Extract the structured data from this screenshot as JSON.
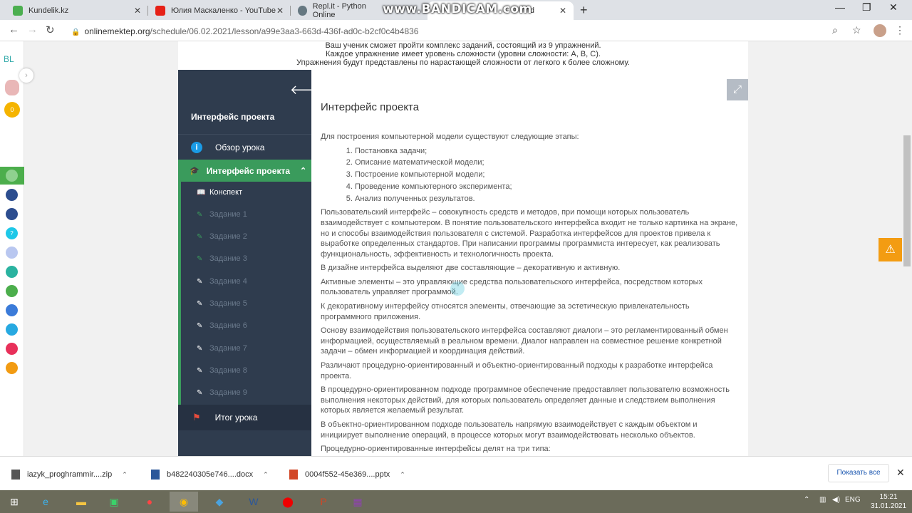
{
  "browser": {
    "tabs": [
      {
        "title": "Kundelik.kz",
        "icon": "kundelik-icon",
        "color": "#4caf50"
      },
      {
        "title": "Юлия Маскаленко - YouTube",
        "icon": "youtube-icon",
        "color": "#e62117"
      },
      {
        "title": "Repl.it - Python Online",
        "icon": "replit-icon",
        "color": "#667881"
      },
      {
        "title": "nd",
        "icon": "page-icon",
        "color": "#aaaaaa"
      }
    ],
    "watermark": "www.BANDICAM.com",
    "url_host": "onlinemektep.org",
    "url_path": "/schedule/06.02.2021/lesson/a99e3aa3-663d-436f-ad0c-b2cf0c4b4836"
  },
  "extension_bar": {
    "logo": "BL",
    "coin": "0"
  },
  "top_notes": [
    "Ваш ученик сможет пройти комплекс заданий, состоящий из 9 упражнений.",
    "Каждое упражнение имеет уровень сложности (уровни сложности: A, B, C).",
    "Упражнения будут представлены по нарастающей сложности от легкого к более сложному."
  ],
  "sidebar": {
    "title": "Интерфейс проекта",
    "overview": "Обзор урока",
    "active_section": "Интерфейс проекта",
    "items": [
      "Конспект",
      "Задание 1",
      "Задание 2",
      "Задание 3",
      "Задание 4",
      "Задание 5",
      "Задание 6",
      "Задание 7",
      "Задание 8",
      "Задание 9"
    ],
    "summary": "Итог урока"
  },
  "content": {
    "title": "Интерфейс проекта",
    "intro": "Для построения компьютерной модели существуют следующие этапы:",
    "stages": [
      "Постановка задачи;",
      "Описание математической модели;",
      "Построение компьютерной модели;",
      "Проведение компьютерного эксперимента;",
      "Анализ полученных результатов."
    ],
    "paragraphs": [
      "Пользовательский интерфейс – совокупность средств и методов, при помощи которых пользователь взаимодействует с компьютером. В понятие пользовательского интерфейса входит не только картинка на экране, но и способы взаимодействия пользователя с системой. Разработка интерфейсов для проектов привела к выработке определенных стандартов. При написании программы программиста интересует, как реализовать функциональность, эффективность и технологичность проекта.",
      "В дизайне интерфейса выделяют две составляющие – декоративную и активную.",
      "Активные элементы – это управляющие средства пользовательского интерфейса, посредством которых пользователь управляет программой.",
      "К декоративному интерфейсу относятся элементы, отвечающие за эстетическую привлекательность программного приложения.",
      "Основу взаимодействия пользовательского интерфейса составляют диалоги – это регламентированный обмен информацией, осуществляемый в реальном времени. Диалог направлен на совместное решение конкретной задачи – обмен информацией и координация действий.",
      "Различают процедурно-ориентированный и объектно-ориентированный подходы к разработке интерфейса проекта.",
      "В процедурно-ориентированном подходе программное обеспечение предоставляет пользователю возможность выполнения некоторых действий, для которых пользователь определяет данные и следствием выполнения которых является желаемый результат.",
      "В объектно-ориентированном подходе пользователь напрямую взаимодействует с каждым объектом и инициирует выполнение операций, в процессе которых могут взаимодействовать несколько объектов.",
      "Процедурно-ориентированные интерфейсы делят на три типа:"
    ]
  },
  "downloads": {
    "files": [
      {
        "name": "iazyk_proghrammir....zip",
        "icon": "zip-file-icon",
        "color": "#555555"
      },
      {
        "name": "b482240305e746....docx",
        "icon": "word-file-icon",
        "color": "#2b579a"
      },
      {
        "name": "0004f552-45e369....pptx",
        "icon": "powerpoint-file-icon",
        "color": "#d24726"
      }
    ],
    "show_all": "Показать все"
  },
  "taskbar": {
    "lang": "ENG",
    "time": "15:21",
    "date": "31.01.2021"
  }
}
